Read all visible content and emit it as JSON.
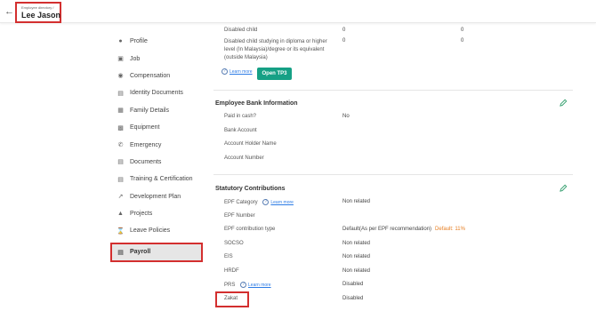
{
  "header": {
    "breadcrumb": "Employee directory /",
    "employee_name": "Lee Jason"
  },
  "sidebar": {
    "items": [
      {
        "label": "Profile"
      },
      {
        "label": "Job"
      },
      {
        "label": "Compensation"
      },
      {
        "label": "Identity Documents"
      },
      {
        "label": "Family Details"
      },
      {
        "label": "Equipment"
      },
      {
        "label": "Emergency"
      },
      {
        "label": "Documents"
      },
      {
        "label": "Training & Certification"
      },
      {
        "label": "Development Plan"
      },
      {
        "label": "Projects"
      },
      {
        "label": "Leave Policies"
      },
      {
        "label": "Payroll"
      }
    ],
    "active_item": "Payroll"
  },
  "tp3": {
    "rows": [
      {
        "label": "Disabled child",
        "v1": "0",
        "v2": "0"
      },
      {
        "label": "Disabled child studying in diploma or higher level (In Malaysia)/degree or its equivalent (outside Malaysia)",
        "v1": "0",
        "v2": "0"
      }
    ],
    "learn_more": "Learn more",
    "button_label": "Open TP3"
  },
  "bank": {
    "title": "Employee Bank Information",
    "fields": [
      {
        "label": "Paid in cash?",
        "value": "No"
      },
      {
        "label": "Bank Account",
        "value": ""
      },
      {
        "label": "Account Holder Name",
        "value": ""
      },
      {
        "label": "Account Number",
        "value": ""
      }
    ]
  },
  "statutory": {
    "title": "Statutory Contributions",
    "learn_more": "Learn more",
    "fields": [
      {
        "label": "EPF Category",
        "value": "Non related"
      },
      {
        "label": "EPF Number",
        "value": ""
      },
      {
        "label": "EPF contribution type",
        "value": "Default(As per EPF recommendation)",
        "note": "Default: 11%"
      },
      {
        "label": "SOCSO",
        "value": "Non related"
      },
      {
        "label": "EIS",
        "value": "Non related"
      },
      {
        "label": "HRDF",
        "value": "Non related"
      },
      {
        "label": "PRS",
        "value": "Disabled"
      },
      {
        "label": "Zakat",
        "value": "Disabled"
      }
    ]
  },
  "colors": {
    "accent": "#16a085",
    "highlight": "#d32f2f",
    "link": "#2c7be5",
    "note": "#e67e22"
  }
}
